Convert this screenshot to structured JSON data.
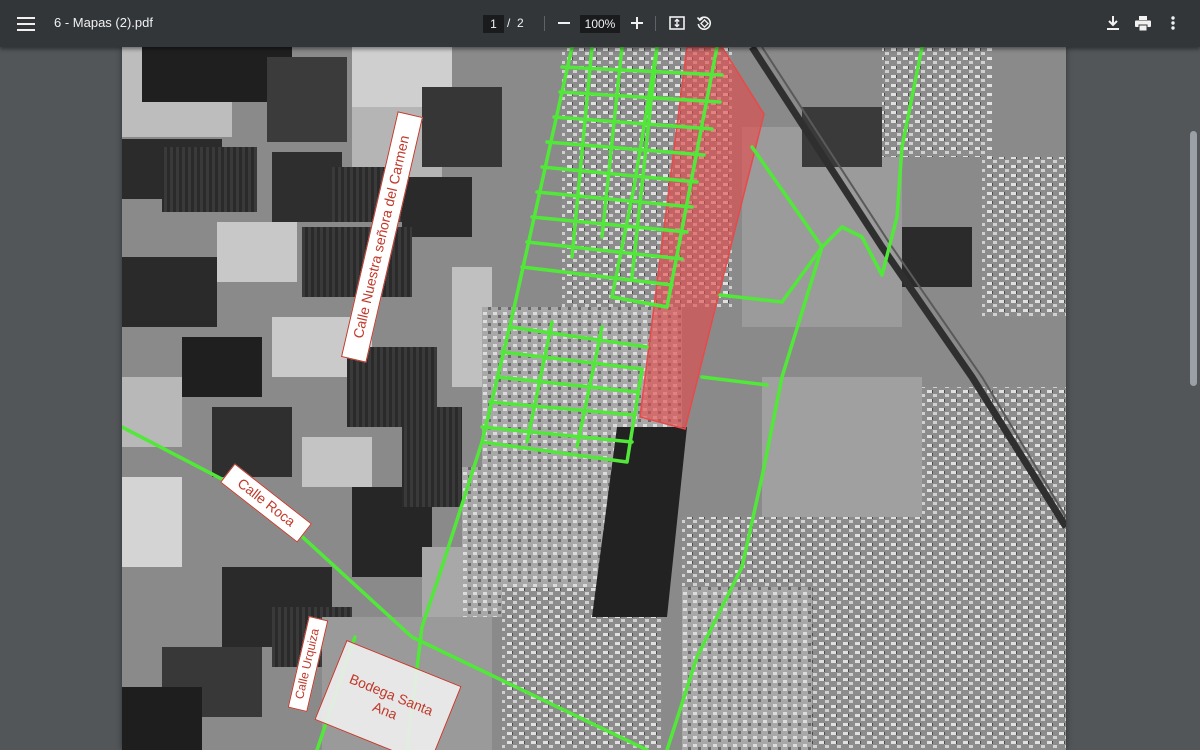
{
  "toolbar": {
    "title": "6 - Mapas (2).pdf",
    "page_current": "1",
    "page_separator": "/",
    "page_total": "2",
    "zoom": "100%",
    "icons": [
      "menu-icon",
      "zoom-out-icon",
      "zoom-in-icon",
      "fit-page-icon",
      "rotate-icon",
      "download-icon",
      "print-icon",
      "more-vert-icon"
    ]
  },
  "map": {
    "labels": {
      "carmen": "Calle Nuestra señora del Carmen",
      "roca": "Calle Roca",
      "urquiza": "Calle Urquiza",
      "bodega": "Bodega Santa Ana"
    },
    "colors": {
      "route": "#52e83a",
      "highlight": "#e64a4a",
      "label_border": "#c0392b"
    }
  },
  "viewer": {
    "scroll_position": 0.12
  }
}
